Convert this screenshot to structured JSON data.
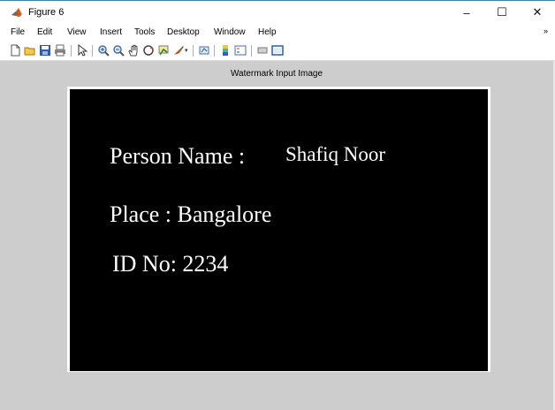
{
  "window": {
    "title": "Figure 6",
    "minimize_glyph": "–",
    "maximize_glyph": "☐",
    "close_glyph": "✕"
  },
  "menu": {
    "items": [
      "File",
      "Edit",
      "View",
      "Insert",
      "Tools",
      "Desktop",
      "Window",
      "Help"
    ],
    "overflow_glyph": "»"
  },
  "toolbar": {
    "icons": [
      "new-figure-icon",
      "open-file-icon",
      "save-icon",
      "print-icon",
      "edit-plot-arrow-icon",
      "zoom-in-icon",
      "zoom-out-icon",
      "pan-hand-icon",
      "rotate-3d-icon",
      "data-cursor-icon",
      "brush-icon",
      "link-plot-icon",
      "colorbar-icon",
      "legend-icon",
      "hide-plot-tools-icon",
      "show-plot-tools-icon"
    ]
  },
  "figure": {
    "axes_title": "Watermark Input Image",
    "image_lines": {
      "person_label": "Person Name :",
      "person_value": "Shafiq Noor",
      "place": "Place : Bangalore",
      "id": "ID No: 2234"
    }
  },
  "colors": {
    "figure_bg": "#cdcdcd",
    "image_bg": "#000000",
    "image_text": "#ffffff",
    "title_border": "#3c7fb1"
  }
}
